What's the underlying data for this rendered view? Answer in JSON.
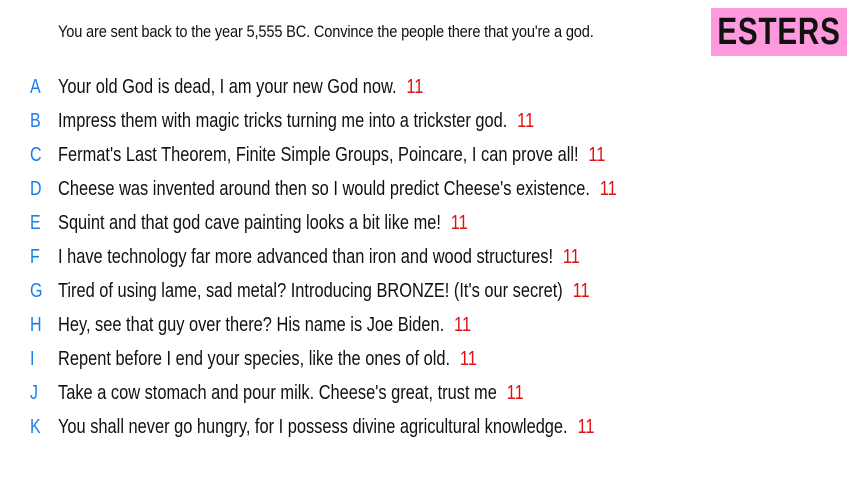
{
  "prompt": "You are sent back to the year 5,555 BC. Convince the people there that you're a god.",
  "badge": "ESTERS",
  "colors": {
    "badge_bg": "#ff99dd",
    "letter": "#1a7ee8",
    "score": "#e01010"
  },
  "options": [
    {
      "letter": "A",
      "text": "Your old God is dead, I am your new God now.",
      "score": "11"
    },
    {
      "letter": "B",
      "text": "Impress them with magic tricks turning me into a trickster god.",
      "score": "11"
    },
    {
      "letter": "C",
      "text": "Fermat's Last Theorem, Finite Simple Groups, Poincare, I can prove all!",
      "score": "11"
    },
    {
      "letter": "D",
      "text": "Cheese was invented around then so I would predict Cheese's existence.",
      "score": "11"
    },
    {
      "letter": "E",
      "text": "Squint and that god cave painting looks a bit like me!",
      "score": "11"
    },
    {
      "letter": "F",
      "text": "I have technology far more advanced than iron and wood structures!",
      "score": "11"
    },
    {
      "letter": "G",
      "text": "Tired of using lame, sad metal? Introducing BRONZE! (It's our secret)",
      "score": "11"
    },
    {
      "letter": "H",
      "text": "Hey, see that guy over there? His name is Joe Biden.",
      "score": "11"
    },
    {
      "letter": "I",
      "text": "Repent before I end your species, like the ones of old.",
      "score": "11"
    },
    {
      "letter": "J",
      "text": "Take a cow stomach and pour milk. Cheese's great, trust me",
      "score": "11"
    },
    {
      "letter": "K",
      "text": "You shall never go hungry, for I possess divine agricultural knowledge.",
      "score": "11"
    }
  ]
}
